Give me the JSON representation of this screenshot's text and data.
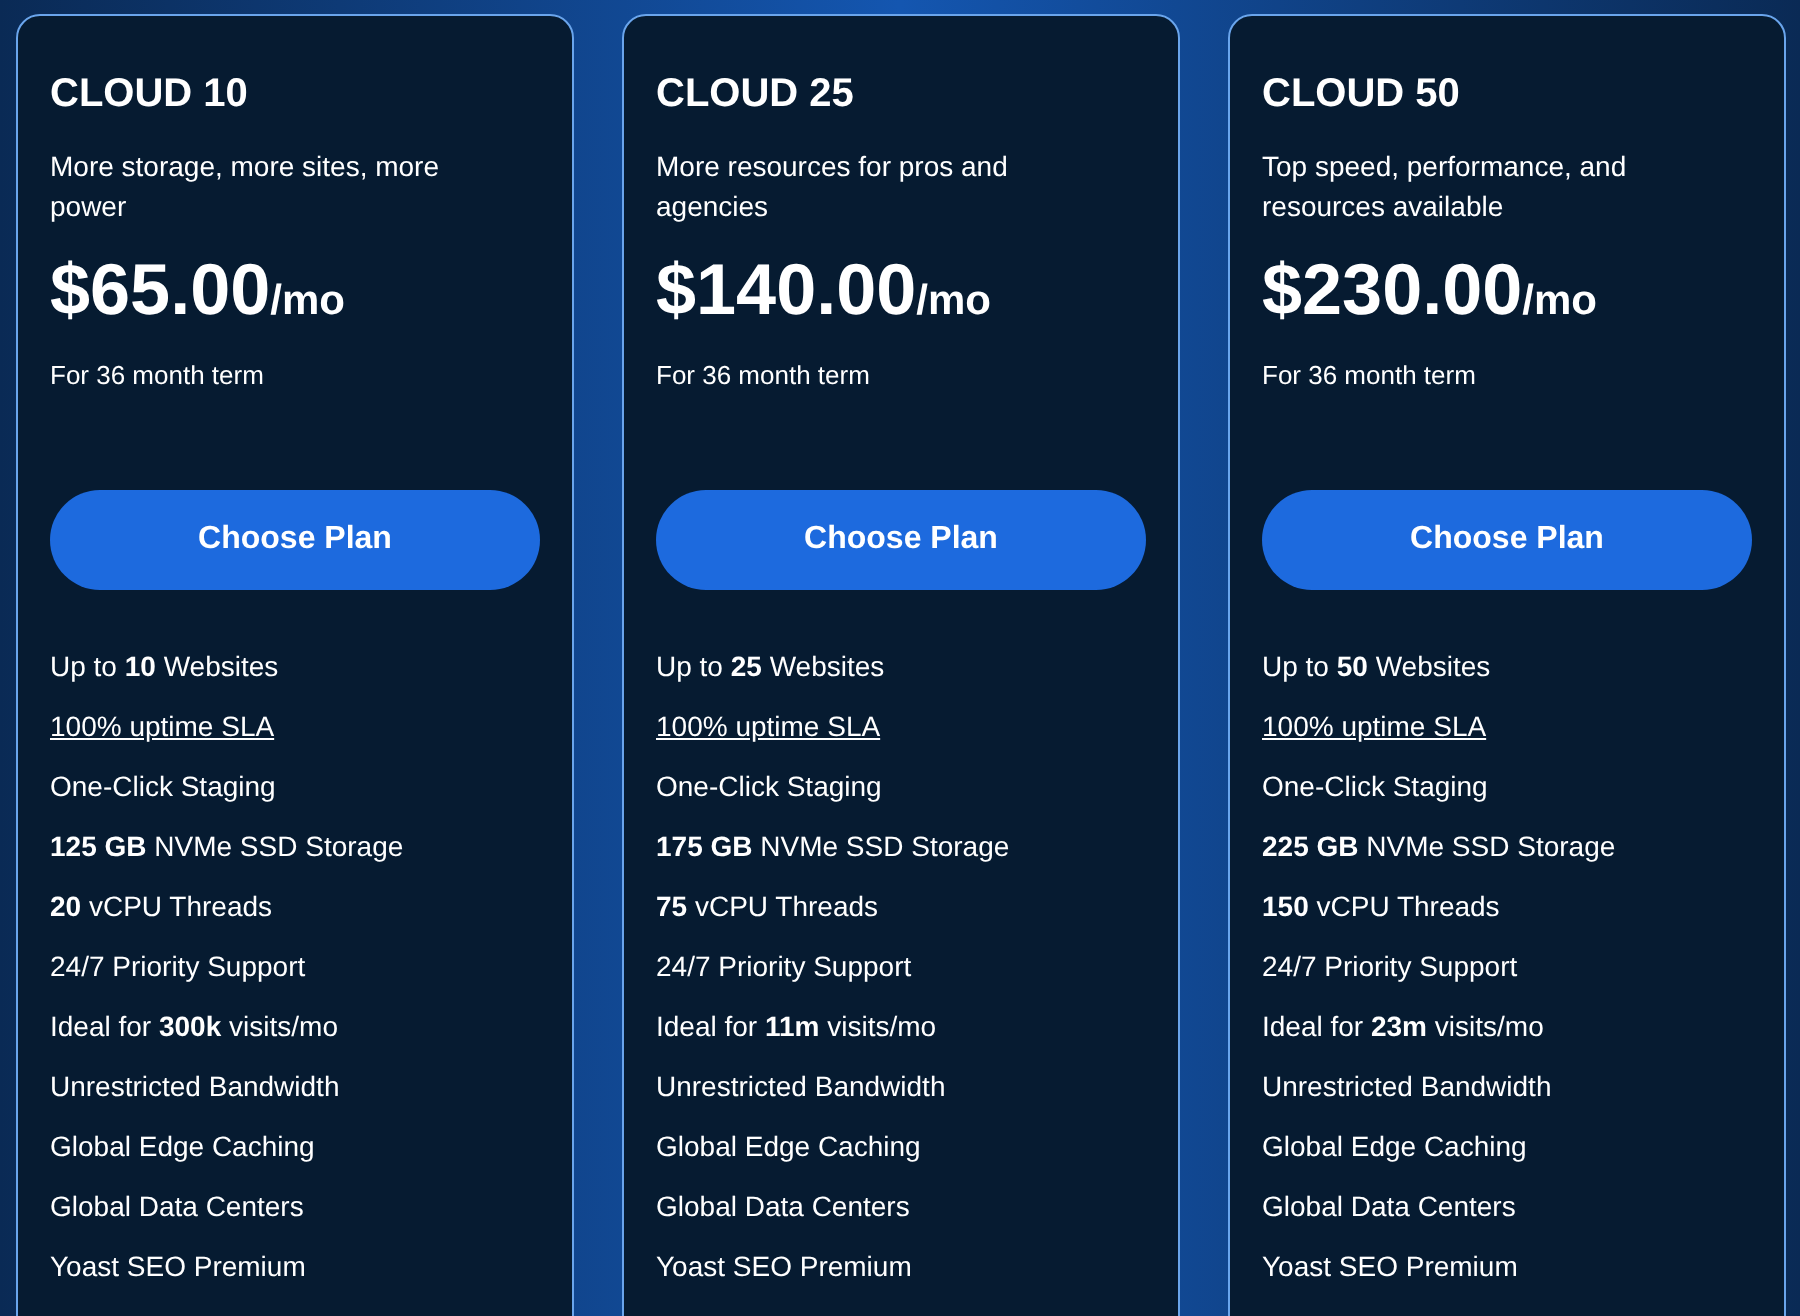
{
  "plans": [
    {
      "name": "CLOUD 10",
      "description": "More storage, more sites, more power",
      "price": "$65.00",
      "period": "/mo",
      "term": "For 36 month term",
      "button": "Choose Plan",
      "features": [
        {
          "kind": "text",
          "text": "Up to **10** Websites"
        },
        {
          "kind": "link",
          "text": "100% uptime SLA"
        },
        {
          "kind": "text",
          "text": "One-Click Staging"
        },
        {
          "kind": "text",
          "text": "**125 GB** NVMe SSD Storage"
        },
        {
          "kind": "text",
          "text": "**20** vCPU Threads"
        },
        {
          "kind": "text",
          "text": "24/7 Priority Support"
        },
        {
          "kind": "text",
          "text": "Ideal for **300k** visits/mo"
        },
        {
          "kind": "text",
          "text": "Unrestricted Bandwidth"
        },
        {
          "kind": "text",
          "text": "Global Edge Caching"
        },
        {
          "kind": "text",
          "text": "Global Data Centers"
        },
        {
          "kind": "text",
          "text": "Yoast SEO Premium"
        }
      ]
    },
    {
      "name": "CLOUD 25",
      "description": "More resources for pros and agencies",
      "price": "$140.00",
      "period": "/mo",
      "term": "For 36 month term",
      "button": "Choose Plan",
      "features": [
        {
          "kind": "text",
          "text": "Up to **25** Websites"
        },
        {
          "kind": "link",
          "text": "100% uptime SLA"
        },
        {
          "kind": "text",
          "text": "One-Click Staging"
        },
        {
          "kind": "text",
          "text": "**175 GB** NVMe SSD Storage"
        },
        {
          "kind": "text",
          "text": "**75** vCPU Threads"
        },
        {
          "kind": "text",
          "text": "24/7 Priority Support"
        },
        {
          "kind": "text",
          "text": "Ideal for **11m** visits/mo"
        },
        {
          "kind": "text",
          "text": "Unrestricted Bandwidth"
        },
        {
          "kind": "text",
          "text": "Global Edge Caching"
        },
        {
          "kind": "text",
          "text": "Global Data Centers"
        },
        {
          "kind": "text",
          "text": "Yoast SEO Premium"
        }
      ]
    },
    {
      "name": "CLOUD 50",
      "description": "Top speed, performance, and resources available",
      "price": "$230.00",
      "period": "/mo",
      "term": "For 36 month term",
      "button": "Choose Plan",
      "features": [
        {
          "kind": "text",
          "text": "Up to **50** Websites"
        },
        {
          "kind": "link",
          "text": "100% uptime SLA"
        },
        {
          "kind": "text",
          "text": "One-Click Staging"
        },
        {
          "kind": "text",
          "text": "**225 GB** NVMe SSD Storage"
        },
        {
          "kind": "text",
          "text": "**150** vCPU Threads"
        },
        {
          "kind": "text",
          "text": "24/7 Priority Support"
        },
        {
          "kind": "text",
          "text": "Ideal for **23m** visits/mo"
        },
        {
          "kind": "text",
          "text": "Unrestricted Bandwidth"
        },
        {
          "kind": "text",
          "text": "Global Edge Caching"
        },
        {
          "kind": "text",
          "text": "Global Data Centers"
        },
        {
          "kind": "text",
          "text": "Yoast SEO Premium"
        }
      ]
    }
  ]
}
